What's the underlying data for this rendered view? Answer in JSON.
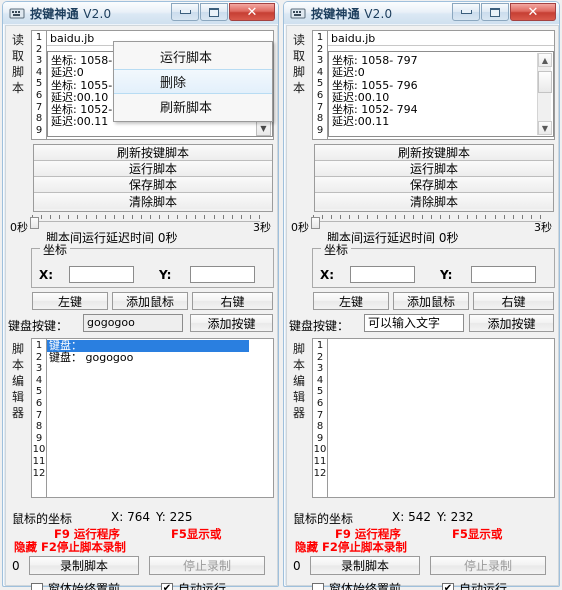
{
  "window": {
    "title_main": "按键神通",
    "title_version": "V2.0",
    "icon": "app-icon",
    "minimize": "–",
    "maximize": "□",
    "close": "✕"
  },
  "labels": {
    "read_script_vertical": "读取脚本",
    "script_editor_vertical": "脚本编辑器",
    "keyboard_key_label": "键盘按键：",
    "coord_group": "坐标",
    "x_label": "X:",
    "y_label": "Y:",
    "mouse_coord_label": "鼠标的坐标",
    "recorded_count": "0"
  },
  "buttons": {
    "refresh_key_script": "刷新按键脚本",
    "run_script": "运行脚本",
    "save_script": "保存脚本",
    "clear_script": "清除脚本",
    "left_click": "左键",
    "add_mouse": "添加鼠标",
    "right_click": "右键",
    "add_key": "添加按键",
    "record_script": "录制脚本",
    "stop_record": "停止录制"
  },
  "slider": {
    "min_label": "0秒",
    "max_label": "3秒",
    "caption": "脚本间运行延迟时间 0秒",
    "value": 0,
    "ticks": 26
  },
  "checkboxes": {
    "always_on_top": {
      "label": "窗体始终置前",
      "checked": false,
      "glyph": ""
    },
    "auto_run": {
      "label": "自动运行",
      "checked": true,
      "glyph": "✔"
    }
  },
  "hotkeys": {
    "line1_a": "F9 运行程序",
    "line1_b": "F5显示或",
    "line2": "隐藏  F2停止脚本录制"
  },
  "context_menu": {
    "visible_in": "left",
    "items": [
      {
        "label": "运行脚本",
        "selected": false
      },
      {
        "label": "删除",
        "selected": true
      },
      {
        "label": "刷新脚本",
        "selected": false
      }
    ]
  },
  "scrollbar": {
    "up": "▲",
    "down": "▼",
    "combo_arrow": "▼"
  },
  "panels": [
    {
      "id": "left",
      "script_file": "baidu.jb",
      "script_gutter": [
        "1",
        "2",
        "3",
        "4",
        "5",
        "6",
        "7",
        "8",
        "9"
      ],
      "script_lines": [
        "坐标: 1058- 797",
        "延迟:0",
        "坐标: 1055- 796",
        "延迟:00.10",
        "坐标: 1052- 794",
        "延迟:00.11"
      ],
      "keyboard_input_value": "gogogoo",
      "keyboard_input_placeholder": "",
      "editor_gutter": [
        "1",
        "2",
        "3",
        "4",
        "5",
        "6",
        "7",
        "8",
        "9",
        "10",
        "11",
        "12"
      ],
      "editor_lines": [
        {
          "text": "键盘：",
          "selected": true
        },
        {
          "text": "键盘：  gogogoo",
          "selected": false
        }
      ],
      "mouse_x": "X: 764",
      "mouse_y": "Y: 225",
      "refresh_focused": false,
      "show_scrollbar": false,
      "show_combo_arrow": true
    },
    {
      "id": "right",
      "script_file": "baidu.jb",
      "script_gutter": [
        "1",
        "2",
        "3",
        "4",
        "5",
        "6",
        "7",
        "8",
        "9"
      ],
      "script_lines": [
        "坐标: 1058- 797",
        "延迟:0",
        "坐标: 1055- 796",
        "延迟:00.10",
        "坐标: 1052- 794",
        "延迟:00.11"
      ],
      "keyboard_input_value": "",
      "keyboard_input_placeholder": "可以输入文字",
      "editor_gutter": [
        "1",
        "2",
        "3",
        "4",
        "5",
        "6",
        "7",
        "8",
        "9",
        "10",
        "11",
        "12"
      ],
      "editor_lines": [],
      "mouse_x": "X: 542",
      "mouse_y": "Y: 232",
      "refresh_focused": true,
      "show_scrollbar": true,
      "show_combo_arrow": false
    }
  ],
  "colors": {
    "hotkey_red": "#ff0000",
    "selection_blue": "#2a7fe0",
    "title_text": "#1c3d5c",
    "close_red": "#c63f34"
  }
}
